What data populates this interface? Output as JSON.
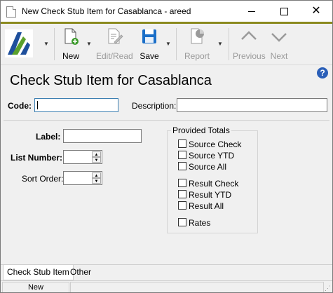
{
  "window": {
    "title": "New Check Stub Item for Casablanca - areed"
  },
  "toolbar": {
    "new_label": "New",
    "edit_read_label": "Edit/Read",
    "save_label": "Save",
    "report_label": "Report",
    "previous_label": "Previous",
    "next_label": "Next"
  },
  "page": {
    "heading": "Check Stub Item for Casablanca",
    "help_glyph": "?"
  },
  "form": {
    "code_label": "Code:",
    "code_value": "",
    "description_label": "Description:",
    "description_value": "",
    "label_label": "Label:",
    "label_value": "",
    "list_number_label": "List Number:",
    "list_number_value": "",
    "sort_order_label": "Sort Order:",
    "sort_order_value": ""
  },
  "provided_totals": {
    "title": "Provided Totals",
    "items": [
      {
        "label": "Source Check",
        "checked": false
      },
      {
        "label": "Source YTD",
        "checked": false
      },
      {
        "label": "Source All",
        "checked": false
      },
      {
        "label": "Result Check",
        "checked": false
      },
      {
        "label": "Result YTD",
        "checked": false
      },
      {
        "label": "Result All",
        "checked": false
      },
      {
        "label": "Rates",
        "checked": false
      }
    ]
  },
  "tabs": [
    {
      "label": "Check Stub Item",
      "active": true
    },
    {
      "label": "Other",
      "active": false
    }
  ],
  "status": {
    "mode": "New"
  },
  "colors": {
    "accent_stripe": "#8b8a1e",
    "logo_green": "#5aa02c",
    "logo_blue": "#1e4f9c",
    "new_icon_green": "#3a9a2a",
    "save_icon_blue": "#1b6fc8",
    "help_blue": "#2b5fb8"
  }
}
